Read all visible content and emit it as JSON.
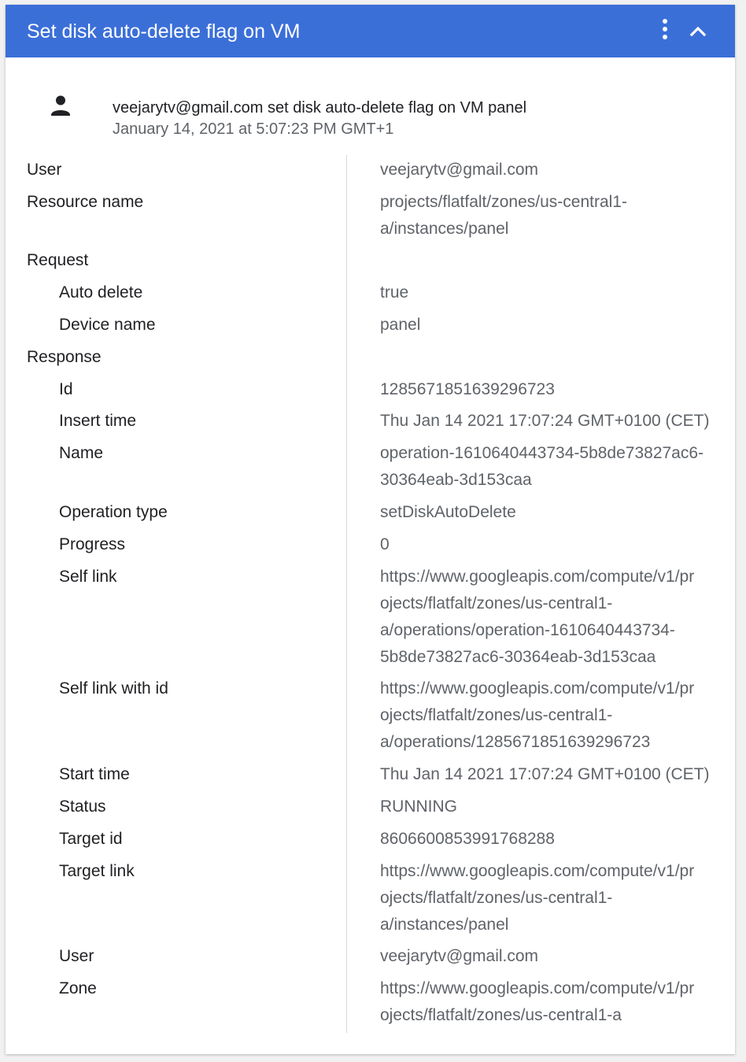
{
  "header": {
    "title": "Set disk auto-delete flag on VM",
    "background": "#3b6fd8"
  },
  "summary": {
    "icon": "person-icon",
    "text": "veejarytv@gmail.com set disk auto-delete flag on VM panel",
    "timestamp": "January 14, 2021 at 5:07:23 PM GMT+1"
  },
  "details": {
    "user": {
      "label": "User",
      "value": "veejarytv@gmail.com"
    },
    "resource_name": {
      "label": "Resource name",
      "value": "projects/flatfalt/zones/us-central1-\na/instances/panel"
    },
    "request": {
      "label": "Request",
      "auto_delete": {
        "label": "Auto delete",
        "value": "true"
      },
      "device_name": {
        "label": "Device name",
        "value": "panel"
      }
    },
    "response": {
      "label": "Response",
      "id": {
        "label": "Id",
        "value": "1285671851639296723"
      },
      "insert_time": {
        "label": "Insert time",
        "value": "Thu Jan 14 2021 17:07:24 GMT+0100 (CET)"
      },
      "name": {
        "label": "Name",
        "value": "operation-1610640443734-5b8de73827ac6-\n30364eab-3d153caa"
      },
      "operation_type": {
        "label": "Operation type",
        "value": "setDiskAutoDelete"
      },
      "progress": {
        "label": "Progress",
        "value": "0"
      },
      "self_link": {
        "label": "Self link",
        "value": "https://www.googleapis.com/compute/v1/pr\nojects/flatfalt/zones/us-central1-\na/operations/operation-1610640443734-\n5b8de73827ac6-30364eab-3d153caa"
      },
      "self_link_with_id": {
        "label": "Self link with id",
        "value": "https://www.googleapis.com/compute/v1/pr\nojects/flatfalt/zones/us-central1-\na/operations/1285671851639296723"
      },
      "start_time": {
        "label": "Start time",
        "value": "Thu Jan 14 2021 17:07:24 GMT+0100 (CET)"
      },
      "status": {
        "label": "Status",
        "value": "RUNNING"
      },
      "target_id": {
        "label": "Target id",
        "value": "8606600853991768288"
      },
      "target_link": {
        "label": "Target link",
        "value": "https://www.googleapis.com/compute/v1/pr\nojects/flatfalt/zones/us-central1-\na/instances/panel"
      },
      "user": {
        "label": "User",
        "value": "veejarytv@gmail.com"
      },
      "zone": {
        "label": "Zone",
        "value": "https://www.googleapis.com/compute/v1/pr\nojects/flatfalt/zones/us-central1-a"
      }
    }
  }
}
